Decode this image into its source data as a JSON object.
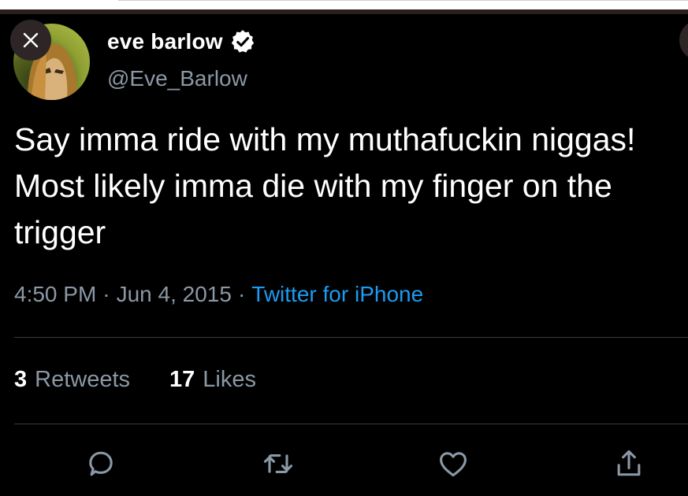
{
  "tweet": {
    "display_name": "eve barlow",
    "handle": "@Eve_Barlow",
    "verified": true,
    "text": "Say imma ride with my muthafuckin niggas! Most likely imma die with my finger on the trigger",
    "time": "4:50 PM",
    "date": "Jun 4, 2015",
    "separator": "·",
    "source": "Twitter for iPhone"
  },
  "stats": {
    "retweets_count": "3",
    "retweets_label": "Retweets",
    "likes_count": "17",
    "likes_label": "Likes"
  },
  "icons": {
    "close": "close-icon",
    "verified": "verified-badge-icon",
    "reply": "reply-icon",
    "retweet": "retweet-icon",
    "like": "heart-icon",
    "share": "share-icon"
  },
  "colors": {
    "background": "#000000",
    "secondary_text": "#8b98a5",
    "link": "#1d9bf0",
    "icon": "#8b98a5"
  }
}
